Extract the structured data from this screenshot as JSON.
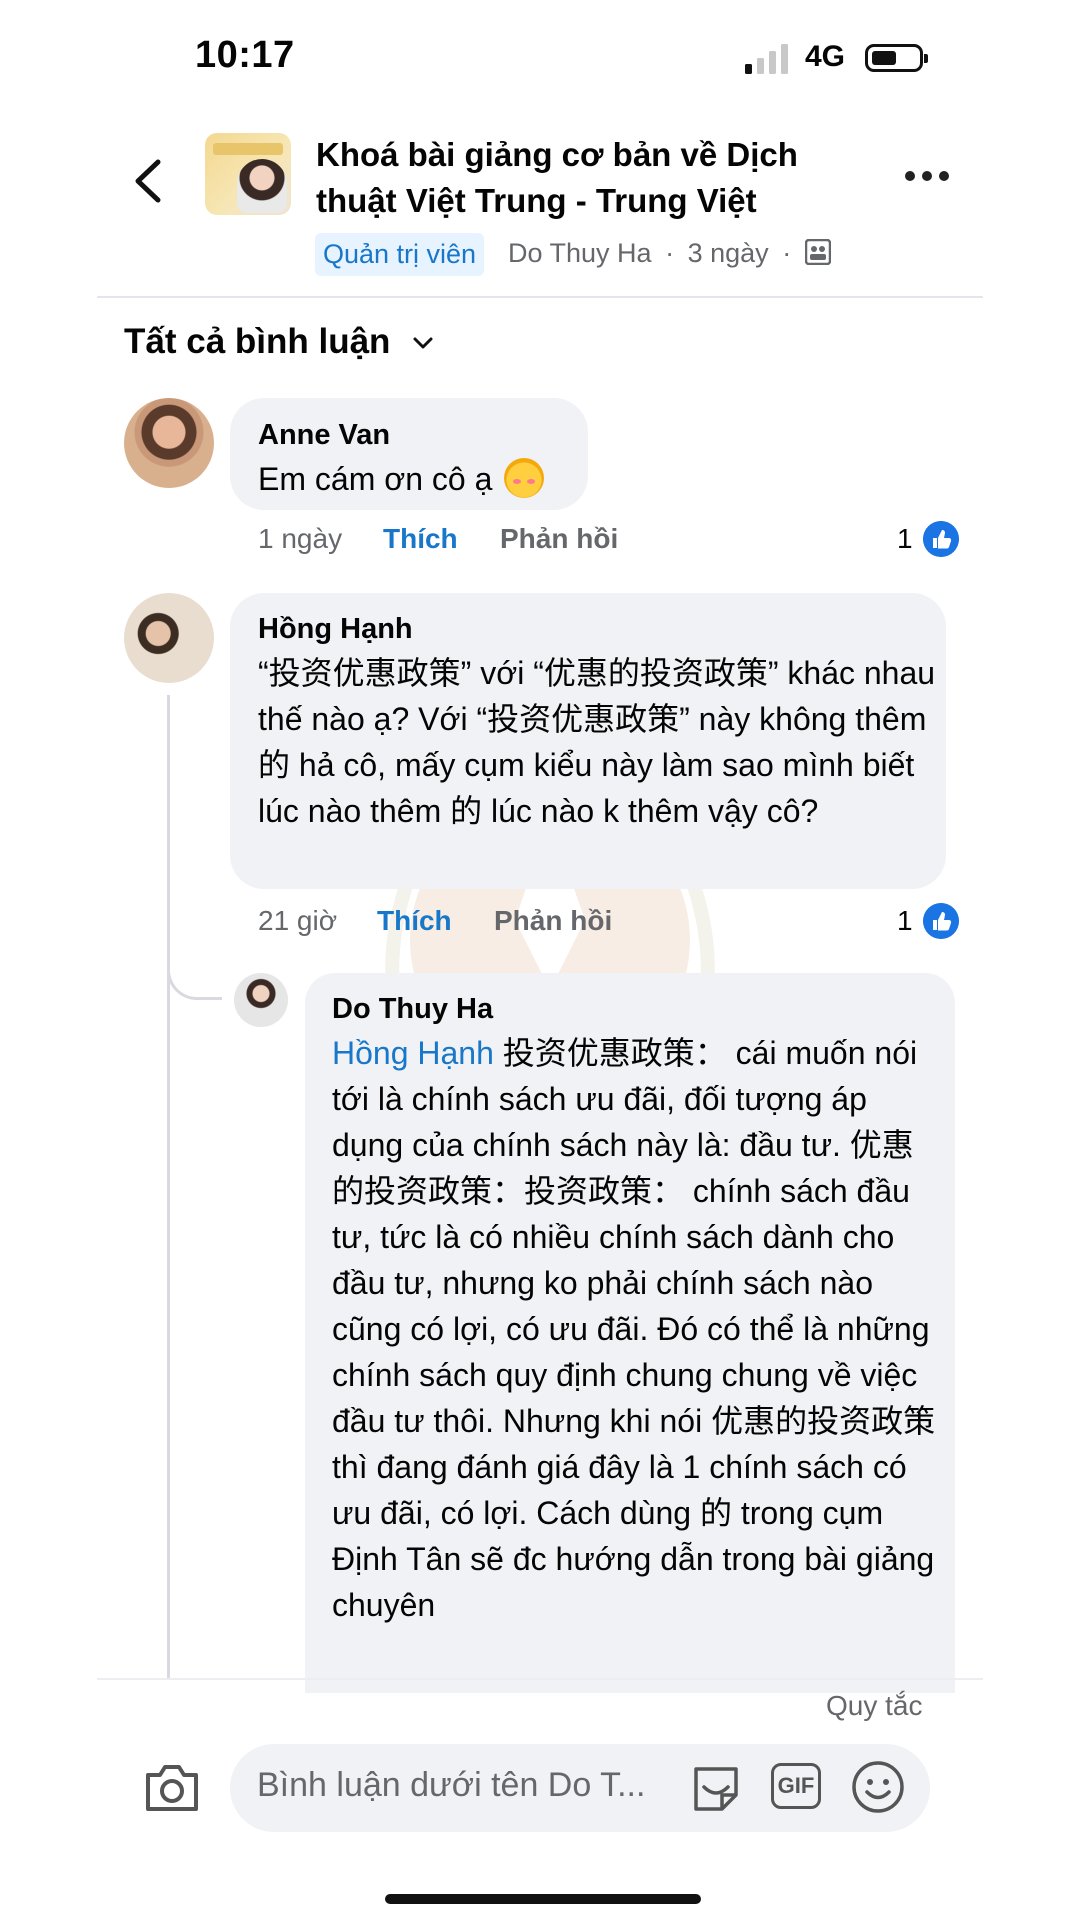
{
  "status_bar": {
    "time": "10:17",
    "network": "4G"
  },
  "header": {
    "group_title": "Khoá bài giảng cơ bản về Dịch thuật Việt Trung - Trung Việt",
    "admin_badge": "Quản trị viên",
    "author": "Do Thuy Ha",
    "age": "3 ngày",
    "separator": "·"
  },
  "filter": {
    "label": "Tất cả bình luận"
  },
  "comments": [
    {
      "author": "Anne Van",
      "text": "Em cám ơn cô ạ",
      "time": "1 ngày",
      "like_label": "Thích",
      "reply_label": "Phản hồi",
      "reactions": "1"
    },
    {
      "author": "Hồng Hạnh",
      "text": "“投资优惠政策” với “优惠的投资政策” khác nhau thế nào ạ? Với “投资优惠政策” này không thêm 的 hả cô, mấy cụm kiểu này làm sao mình biết lúc nào thêm 的 lúc nào k thêm vậy cô?",
      "time": "21 giờ",
      "like_label": "Thích",
      "reply_label": "Phản hồi",
      "reactions": "1"
    }
  ],
  "reply": {
    "author": "Do Thuy Ha",
    "mention": "Hồng Hạnh",
    "text": "投资优惠政策： cái muốn nói tới là chính sách ưu đãi, đối tượng áp dụng của chính sách này là: đầu tư. 优惠的投资政策：投资政策： chính sách đầu tư, tức là có nhiều chính sách dành cho đầu tư, nhưng ko phải chính sách nào cũng có lợi, có ưu đãi. Đó có thể là những chính sách quy định chung chung về việc đầu tư thôi. Nhưng khi nói 优惠的投资政策 thì đang đánh giá đây là 1 chính sách có ưu đãi, có lợi. Cách dùng 的 trong cụm Định Tân sẽ đc hướng dẫn trong bài giảng chuyên"
  },
  "composer": {
    "rules_link": "Quy tắc",
    "placeholder": "Bình luận dưới tên Do T...",
    "gif_label": "GIF"
  },
  "colors": {
    "accent": "#1877c9",
    "bubble": "#f0f2f5",
    "like_badge": "#1b74e4"
  }
}
